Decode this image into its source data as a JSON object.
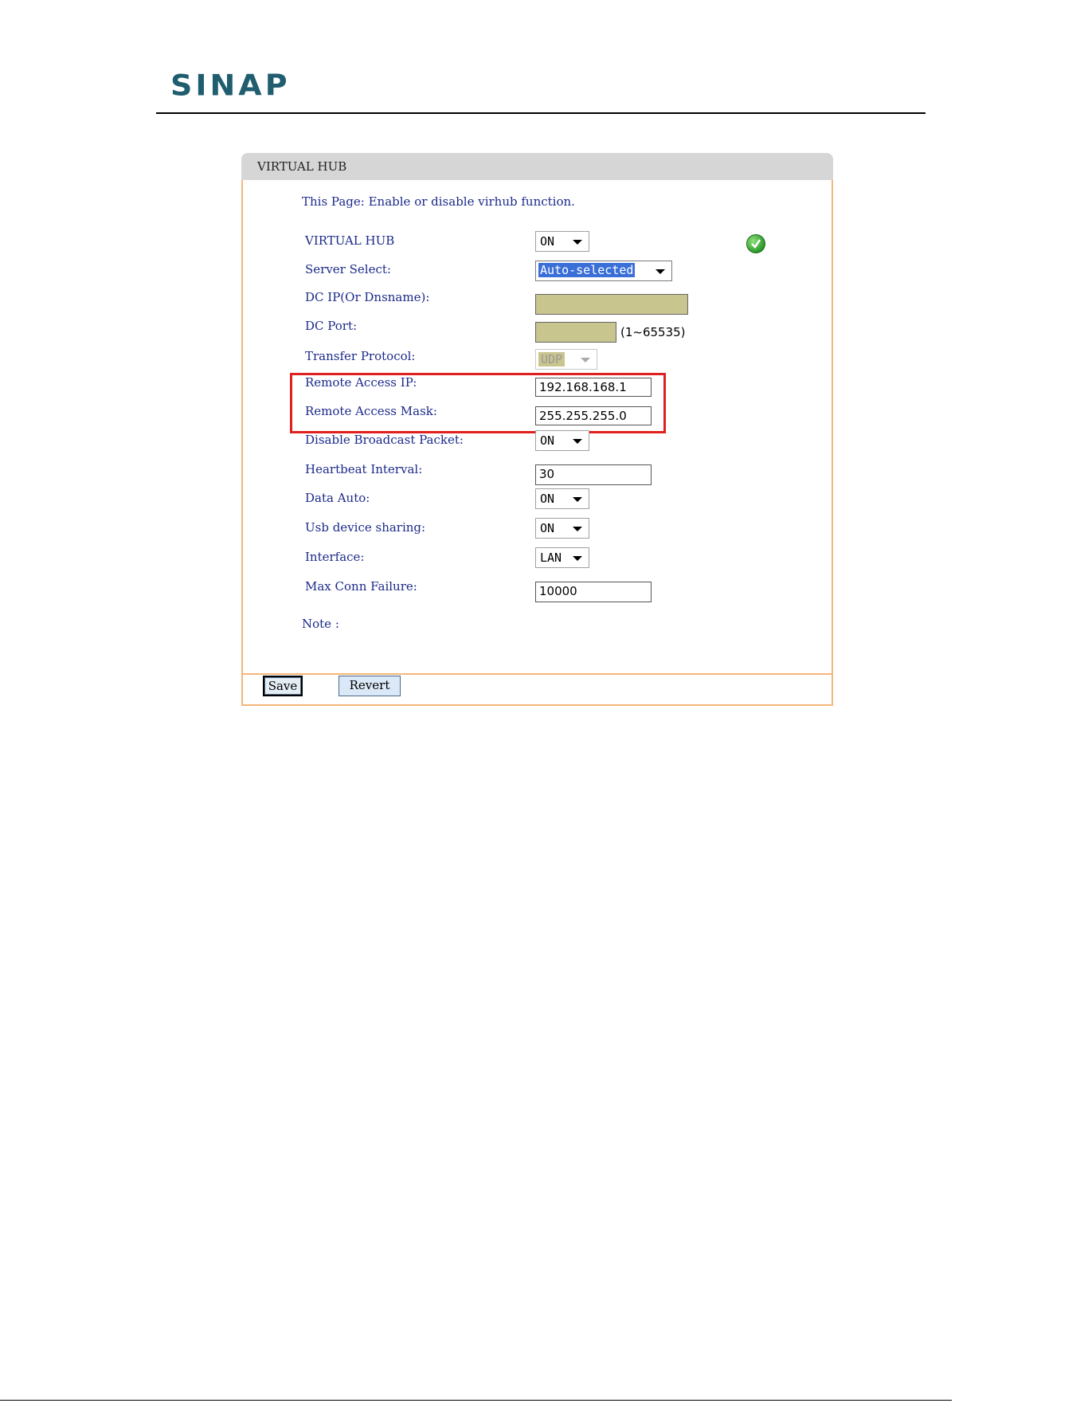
{
  "brand": {
    "logo": "SINAP"
  },
  "panel": {
    "title": "VIRTUAL HUB",
    "intro": "This Page: Enable or disable virhub function.",
    "status_icon": "check-icon",
    "fields": {
      "virtual_hub": {
        "label": "VIRTUAL HUB",
        "value": "ON"
      },
      "server_select": {
        "label": "Server Select:",
        "value": "Auto-selected"
      },
      "dc_ip": {
        "label": "DC IP(Or Dnsname):",
        "value": ""
      },
      "dc_port": {
        "label": "DC Port:",
        "value": "",
        "hint": "(1~65535)"
      },
      "transfer_protocol": {
        "label": "Transfer Protocol:",
        "value": "UDP"
      },
      "remote_access_ip": {
        "label": "Remote Access IP:",
        "value": "192.168.168.1"
      },
      "remote_access_mask": {
        "label": "Remote Access Mask:",
        "value": "255.255.255.0"
      },
      "disable_broadcast": {
        "label": "Disable Broadcast Packet:",
        "value": "ON"
      },
      "heartbeat_interval": {
        "label": "Heartbeat Interval:",
        "value": "30"
      },
      "data_auto": {
        "label": "Data Auto:",
        "value": "ON"
      },
      "usb_sharing": {
        "label": "Usb device sharing:",
        "value": "ON"
      },
      "interface": {
        "label": "Interface:",
        "value": "LAN"
      },
      "max_conn_failure": {
        "label": "Max Conn Failure:",
        "value": "10000"
      }
    },
    "note": "Note :",
    "buttons": {
      "save": "Save",
      "revert": "Revert"
    }
  },
  "colors": {
    "highlight_box": "#e02020",
    "panel_border": "#f3b67a",
    "label_text": "#1b2a8a"
  }
}
